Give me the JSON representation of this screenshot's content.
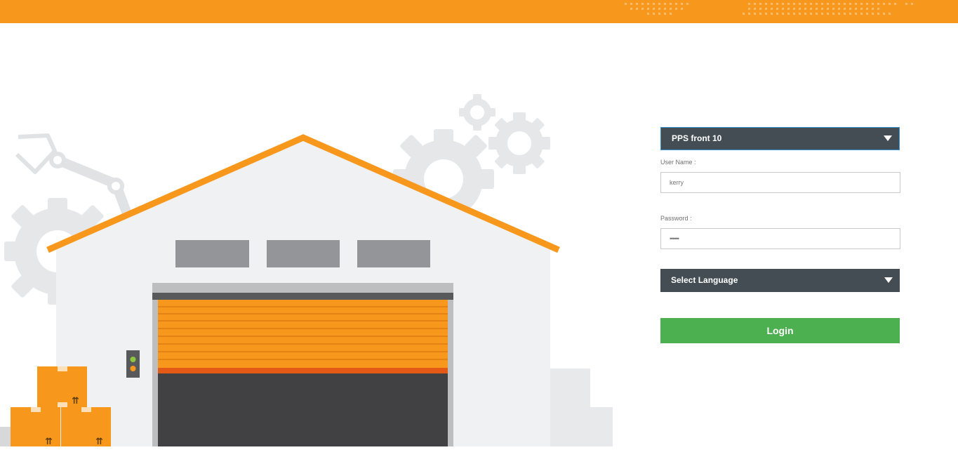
{
  "header": {
    "bar_color": "#f7981d"
  },
  "login": {
    "server_select": "PPS front 10",
    "username_label": "User Name :",
    "username_value": "kerry",
    "password_label": "Password :",
    "password_value": "••••••",
    "language_select": "Select Language",
    "login_button": "Login"
  },
  "colors": {
    "accent": "#f7981d",
    "select_bg": "#444d54",
    "login_green": "#4caf50"
  },
  "icons": [
    "chevron-down-icon",
    "warehouse-illustration",
    "gear-icon",
    "robot-arm-icon",
    "box-icon",
    "traffic-light-icon"
  ]
}
